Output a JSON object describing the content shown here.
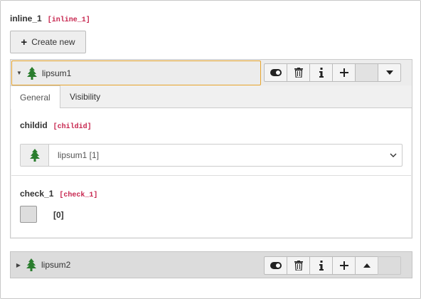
{
  "field": {
    "label": "inline_1",
    "code": "[inline_1]"
  },
  "create_button": {
    "label": "Create new"
  },
  "records": [
    {
      "title": "lipsum1",
      "expanded": true,
      "tabs": [
        "General",
        "Visibility"
      ],
      "active_tab": "General",
      "childid": {
        "label": "childid",
        "code": "[childid]",
        "value": "lipsum1 [1]"
      },
      "check": {
        "label": "check_1",
        "code": "[check_1]",
        "value": "[0]",
        "checked": false
      }
    },
    {
      "title": "lipsum2",
      "expanded": false
    }
  ],
  "colors": {
    "highlight_border": "#e8a42b",
    "code_text": "#c7254e",
    "tree_icon": "#2a7d2e"
  },
  "icons": {
    "toggle": "toggle-icon",
    "delete": "trash-icon",
    "info": "info-icon",
    "add": "plus-icon",
    "move_down": "arrow-down-icon",
    "move_up": "arrow-up-icon",
    "record": "tree-icon"
  }
}
